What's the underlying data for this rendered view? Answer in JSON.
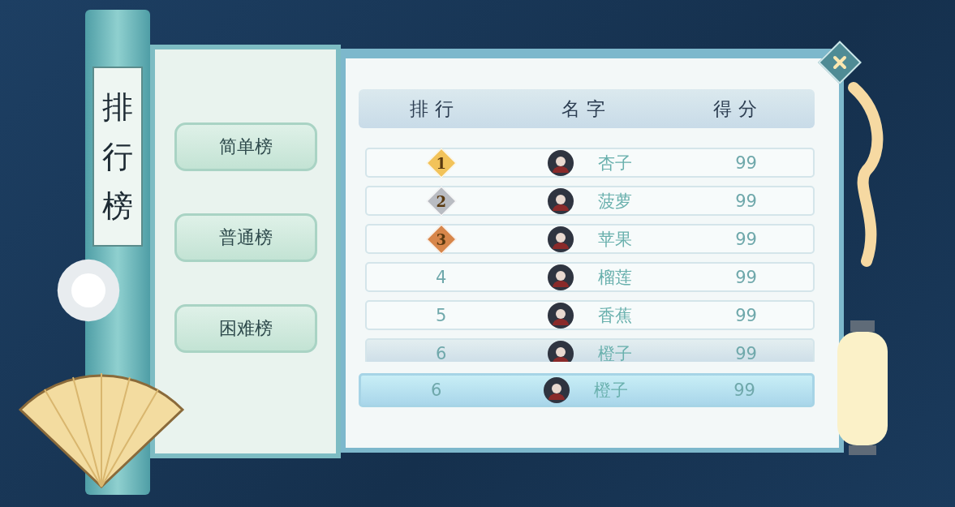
{
  "title": "排行榜",
  "tabs": [
    {
      "label": "简单榜"
    },
    {
      "label": "普通榜"
    },
    {
      "label": "困难榜"
    }
  ],
  "columns": [
    "排行",
    "名字",
    "得分"
  ],
  "rows": [
    {
      "kind": "medal",
      "rank": "1",
      "color": "#f2c35a",
      "name": "杏子",
      "score": "99"
    },
    {
      "kind": "medal",
      "rank": "2",
      "color": "#b9bcc2",
      "name": "菠萝",
      "score": "99"
    },
    {
      "kind": "medal",
      "rank": "3",
      "color": "#d7864a",
      "name": "苹果",
      "score": "99"
    },
    {
      "kind": "plain",
      "rank": "4",
      "name": "榴莲",
      "score": "99"
    },
    {
      "kind": "plain",
      "rank": "5",
      "name": "香蕉",
      "score": "99"
    },
    {
      "kind": "plain",
      "rank": "6",
      "name": "橙子",
      "score": "99"
    }
  ],
  "self_row": {
    "rank": "6",
    "name": "橙子",
    "score": "99"
  }
}
